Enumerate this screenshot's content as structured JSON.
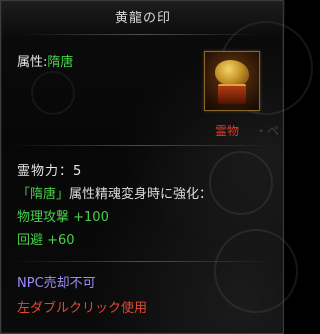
{
  "tooltip": {
    "title": "黄龍の印",
    "attribute_label": "属性:",
    "attribute_value": "隋唐",
    "item_label": "霊物",
    "item_label_extra": "・ペ",
    "spirit_power": "霊物力：5",
    "bonus_tag": "「隋唐」",
    "bonus_text": "属性精魂変身時に強化：",
    "stat_1": "物理攻撃 +100",
    "stat_2": "回避 +60",
    "npc_note": "NPC売却不可",
    "usage_hint": "左ダブルクリック使用"
  },
  "colors": {
    "attribute_green": "#47d04a",
    "item_label_red": "#e23a2a",
    "npc_purple": "#9a8cff",
    "usage_red": "#e04a34"
  },
  "icons": {
    "item": "golden-dragon-seal-icon"
  }
}
